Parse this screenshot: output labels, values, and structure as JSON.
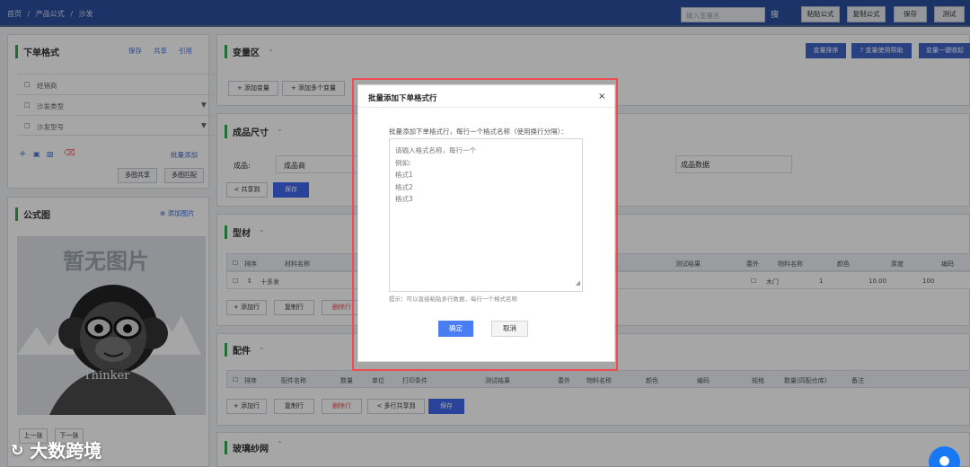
{
  "topbar": {
    "breadcrumb": [
      "首页",
      "/",
      "产品公式",
      "/",
      "沙发"
    ],
    "search_placeholder": "输入变量名",
    "search_icon": "搜",
    "buttons": [
      "粘贴公式",
      "复制公式",
      "保存",
      "测试"
    ]
  },
  "left_top": {
    "title": "下单格式",
    "links": [
      "保存",
      "共享",
      "引用"
    ],
    "rows": [
      "经销商",
      "沙发类型",
      "沙发型号"
    ],
    "batch_add": "批量添加",
    "buttons": [
      "多图共享",
      "多图匹配"
    ]
  },
  "left_formula": {
    "title": "公式图",
    "add_image": "⊕ 添加图片",
    "empty_text": "暂无图片",
    "watermark": "Thinker",
    "nav_buttons": [
      "上一张",
      "下一张"
    ]
  },
  "variables": {
    "title": "变量区",
    "right_buttons": [
      "变量排序",
      "? 变量使用帮助",
      "变量一键收起"
    ],
    "toolbar": [
      "+ 添加变量",
      "+ 添加多个变量"
    ]
  },
  "size_section": {
    "title": "成品尺寸",
    "fields": [
      "成品:",
      "成品商",
      "成品数据"
    ],
    "buttons": [
      "< 共享到",
      "保存"
    ]
  },
  "profile": {
    "title": "型材",
    "headers": [
      "排序",
      "材料名称",
      "测试结果",
      "委外",
      "物料名称",
      "颜色",
      "厚度",
      "编码"
    ],
    "row": [
      "十多发",
      "木门",
      "1",
      "10.00",
      "100"
    ],
    "actions": [
      "+ 添加行",
      "复制行",
      "删除行"
    ]
  },
  "accessory": {
    "title": "配件",
    "headers": [
      "排序",
      "配件名称",
      "数量",
      "单位",
      "打印条件",
      "测试结果",
      "委外",
      "物料名称",
      "颜色",
      "编码",
      "规格",
      "数量(四配仓库)",
      "备注"
    ],
    "actions": [
      "+ 添加行",
      "复制行",
      "删除行",
      "< 多行共享到",
      "保存"
    ]
  },
  "glass": {
    "title": "玻璃纱网"
  },
  "dialog": {
    "title": "批量添加下单格式行",
    "description": "批量添加下单格式行，每行一个格式名称（使用换行分隔）：",
    "placeholder_lines": [
      "请输入格式名称，每行一个",
      "例如:",
      "格式1",
      "格式2",
      "格式3"
    ],
    "hint": "提示：可以直接粘贴多行数据，每行一个格式名称",
    "confirm": "确定",
    "cancel": "取消"
  },
  "branding": {
    "logo": "大数跨境"
  },
  "colors": {
    "topbar": "#2b4f9e",
    "primary": "#4067ed",
    "highlight": "#ef4b53",
    "accent": "#34a853"
  }
}
